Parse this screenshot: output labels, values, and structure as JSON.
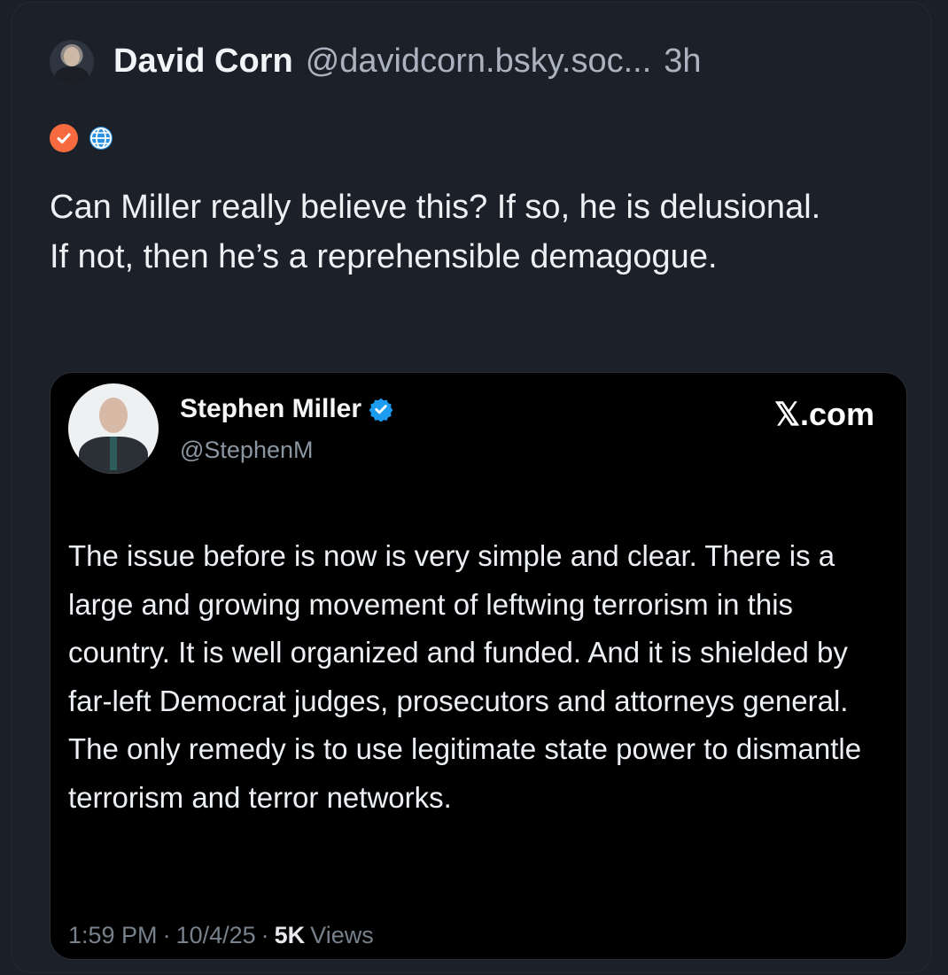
{
  "post": {
    "display_name": "David Corn",
    "handle": "@davidcorn.bsky.soc...",
    "time": "3h",
    "badges": [
      "verified-check-icon",
      "globe-icon"
    ],
    "text": "Can Miller really believe this? If so, he is delusional. If not, then he’s a reprehensible demagogue."
  },
  "quote": {
    "display_name": "Stephen Miller",
    "handle": "@StephenM",
    "source": "𝕏.com",
    "text": "The issue before is now is very simple and clear. There is a large and growing movement of leftwing terrorism in this country. It is well organized and funded. And it is shielded by far-left Democrat judges, prosecutors and attorneys general. The only remedy is to use legitimate state power to dismantle terrorism and terror networks.",
    "meta": {
      "time": "1:59 PM",
      "date": "10/4/25",
      "views_count": "5K",
      "views_label": "Views",
      "separator": "·"
    }
  },
  "colors": {
    "background": "#1c2129",
    "quote_background": "#000000",
    "badge_orange": "#f56b3f",
    "verified_blue": "#1d9bf0"
  }
}
